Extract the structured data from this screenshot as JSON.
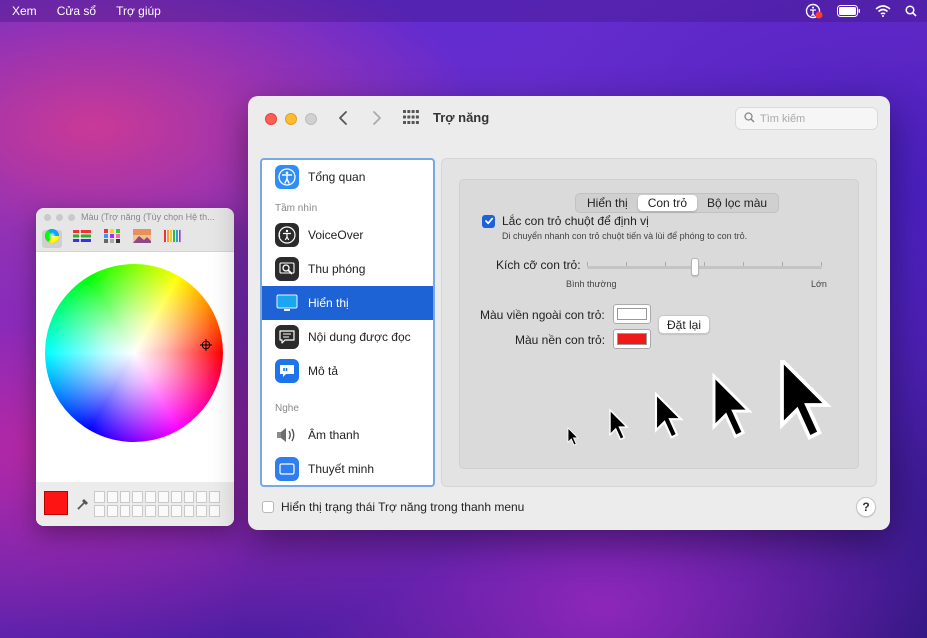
{
  "menubar": {
    "items": [
      "Xem",
      "Cửa sổ",
      "Trợ giúp"
    ],
    "status_icons": [
      "accessibility-status-icon",
      "battery-icon",
      "wifi-icon",
      "spotlight-search-icon"
    ]
  },
  "color_panel": {
    "title": "Màu (Trợ năng (Tùy chọn Hệ th...",
    "tools": [
      "color-wheel-icon",
      "color-sliders-icon",
      "color-palettes-icon",
      "image-palettes-icon",
      "pencils-icon"
    ],
    "current_color": "#ff1414"
  },
  "window": {
    "title": "Trợ năng",
    "search_placeholder": "Tìm kiếm",
    "sidebar": {
      "items": [
        {
          "label": "Tổng quan"
        },
        {
          "section": "Tầm nhìn"
        },
        {
          "label": "VoiceOver"
        },
        {
          "label": "Thu phóng"
        },
        {
          "label": "Hiển thị",
          "selected": true
        },
        {
          "label": "Nội dung được đọc"
        },
        {
          "label": "Mô tả"
        },
        {
          "section": "Nghe"
        },
        {
          "label": "Âm thanh"
        },
        {
          "label": "Thuyết minh"
        }
      ],
      "section_vision": "Tầm nhìn",
      "section_hearing": "Nghe"
    },
    "tabs": [
      "Hiển thị",
      "Con trỏ",
      "Bộ lọc màu"
    ],
    "active_tab": "Con trỏ",
    "pointer": {
      "shake_label": "Lắc con trỏ chuột để định vị",
      "shake_checked": true,
      "shake_desc": "Di chuyển nhanh con trỏ chuột tiến và lùi để phóng to con trỏ.",
      "size_label": "Kích cỡ con trỏ:",
      "size_min": "Bình thường",
      "size_max": "Lớn",
      "size_value": 0.46,
      "outline_label": "Màu viền ngoài con trỏ:",
      "outline_color": "#ffffff",
      "fill_label": "Màu nền con trỏ:",
      "fill_color": "#ee1a1a",
      "reset_label": "Đặt lại"
    },
    "footer_label": "Hiển thị trạng thái Trợ năng trong thanh menu",
    "footer_checked": false,
    "help_label": "?"
  },
  "colors": {
    "accent": "#1d63d6",
    "sidebar_focus": "#7aa7e8"
  }
}
